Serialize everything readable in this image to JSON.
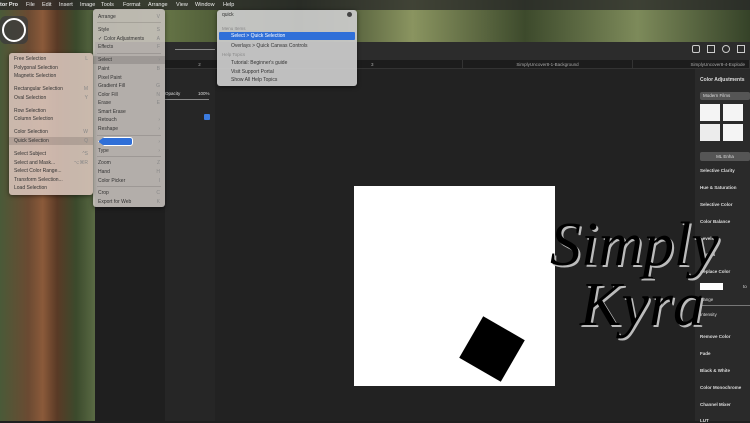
{
  "menubar": {
    "app": "tor Pro",
    "items": [
      "File",
      "Edit",
      "Insert",
      "Image",
      "Tools",
      "Format",
      "Arrange",
      "View",
      "Window",
      "Help"
    ]
  },
  "tabs": [
    "2",
    "3",
    "SimplyUncover8-1-Background",
    "SimplyUncover8-4-Explode"
  ],
  "layers": {
    "opacity_label": "Opacity",
    "opacity_value": "100%"
  },
  "tools_menu": [
    {
      "label": "Arrange",
      "sc": "V"
    },
    {
      "label": "Style",
      "sc": "S"
    },
    {
      "label": "✓ Color Adjustments",
      "sc": "A"
    },
    {
      "label": "Effects",
      "sc": "F"
    },
    {
      "label": "Select",
      "sc": "›"
    },
    {
      "label": "Paint",
      "sc": "B"
    },
    {
      "label": "Pixel Paint",
      "sc": ""
    },
    {
      "label": "Gradient Fill",
      "sc": "G"
    },
    {
      "label": "Color Fill",
      "sc": "N"
    },
    {
      "label": "Erase",
      "sc": "E"
    },
    {
      "label": "Smart Erase",
      "sc": ""
    },
    {
      "label": "Retouch",
      "sc": "›"
    },
    {
      "label": "Reshape",
      "sc": "›"
    },
    {
      "label": "",
      "sc": "›"
    },
    {
      "label": "Type",
      "sc": "›"
    },
    {
      "label": "Zoom",
      "sc": "Z"
    },
    {
      "label": "Hand",
      "sc": "H"
    },
    {
      "label": "Color Picker",
      "sc": "I"
    },
    {
      "label": "Crop",
      "sc": "C"
    },
    {
      "label": "Export for Web",
      "sc": "K"
    }
  ],
  "select_menu": [
    {
      "label": "Free Selection",
      "sc": "L"
    },
    {
      "label": "Polygonal Selection",
      "sc": ""
    },
    {
      "label": "Magnetic Selection",
      "sc": ""
    },
    {
      "label": "Rectangular Selection",
      "sc": "M"
    },
    {
      "label": "Oval Selection",
      "sc": "Y"
    },
    {
      "label": "Row Selection",
      "sc": ""
    },
    {
      "label": "Column Selection",
      "sc": ""
    },
    {
      "label": "Color Selection",
      "sc": "W"
    },
    {
      "label": "Quick Selection",
      "sc": "Q"
    },
    {
      "label": "Select Subject",
      "sc": "^S"
    },
    {
      "label": "Select and Mask...",
      "sc": "⌥⌘R"
    },
    {
      "label": "Select Color Range...",
      "sc": ""
    },
    {
      "label": "Transform Selection...",
      "sc": ""
    },
    {
      "label": "Load Selection",
      "sc": ""
    }
  ],
  "help": {
    "query": "quick",
    "menu_items_header": "Menu Items",
    "menu_items": [
      "Select > Quick Selection",
      "Overlays > Quick Canvas Controls"
    ],
    "help_topics_header": "Help Topics",
    "help_topics": [
      "Tutorial: Beginner's guide",
      "Visit Support Portal",
      "Show All Help Topics"
    ]
  },
  "right_panel": {
    "title": "Color Adjustments",
    "preset": "Modern Films",
    "ml_button": "ML Enha",
    "items": [
      "Selective Clarity",
      "Hue & Saturation",
      "Selective Color",
      "Color Balance",
      "Levels",
      "Curves",
      "Replace Color",
      "Remove Color",
      "Fade",
      "Black & White",
      "Color Monochrome",
      "Channel Mixer",
      "LUT"
    ],
    "range_label": "Range",
    "intensity_label": "Intensity",
    "to_label": "to"
  },
  "watermark": {
    "line1": "Simply",
    "line2": "Kyra"
  }
}
